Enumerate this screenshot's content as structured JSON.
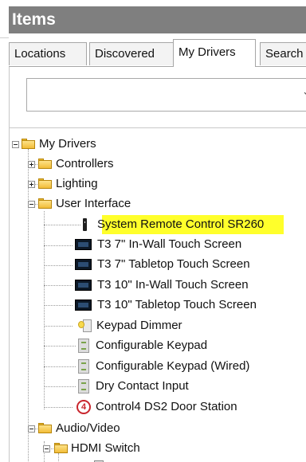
{
  "panel": {
    "title": "Items"
  },
  "tabs": [
    {
      "label": "Locations"
    },
    {
      "label": "Discovered"
    },
    {
      "label": "My Drivers"
    },
    {
      "label": "Search"
    }
  ],
  "dropdown": {
    "value": ""
  },
  "tree": {
    "root": {
      "label": "My Drivers"
    },
    "controllers": {
      "label": "Controllers"
    },
    "lighting": {
      "label": "Lighting"
    },
    "user_interface": {
      "label": "User Interface",
      "items": [
        {
          "label": "System Remote Control SR260",
          "icon": "remote-icon",
          "highlighted": true
        },
        {
          "label": "T3 7\" In-Wall Touch Screen",
          "icon": "touchscreen-icon"
        },
        {
          "label": "T3 7\" Tabletop Touch Screen",
          "icon": "touchscreen-icon"
        },
        {
          "label": "T3 10\" In-Wall Touch Screen",
          "icon": "touchscreen-icon"
        },
        {
          "label": "T3 10\" Tabletop Touch Screen",
          "icon": "touchscreen-icon"
        },
        {
          "label": "Keypad Dimmer",
          "icon": "keypad-dimmer-icon"
        },
        {
          "label": "Configurable Keypad",
          "icon": "keypad-icon"
        },
        {
          "label": "Configurable Keypad (Wired)",
          "icon": "keypad-icon"
        },
        {
          "label": "Dry Contact Input",
          "icon": "keypad-icon"
        },
        {
          "label": "Control4 DS2 Door Station",
          "icon": "control4-logo-icon"
        }
      ]
    },
    "audio_video": {
      "label": "Audio/Video"
    },
    "hdmi_switch": {
      "label": "HDMI Switch"
    }
  },
  "colors": {
    "header_bg": "#7f7f7f",
    "highlight": "#ffff2b",
    "folder": "#f2bd39"
  }
}
